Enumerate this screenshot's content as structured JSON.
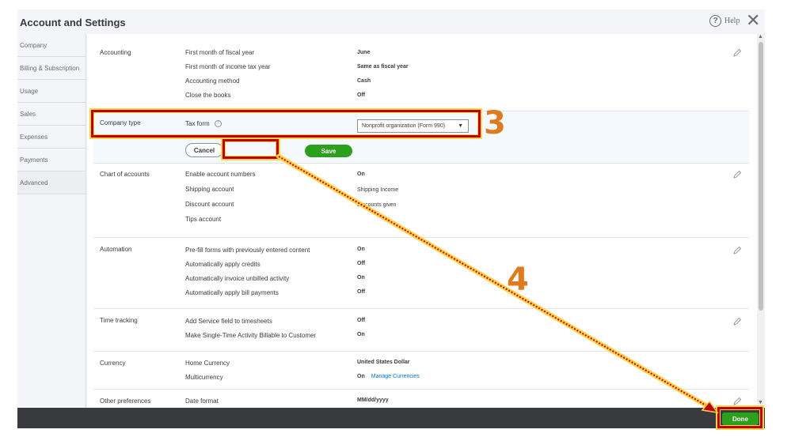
{
  "title": "Account and Settings",
  "help_label": "Help",
  "help_icon": "?",
  "close_icon": "✕",
  "sidebar": {
    "items": [
      {
        "label": "Company"
      },
      {
        "label": "Billing & Subscription"
      },
      {
        "label": "Usage"
      },
      {
        "label": "Sales"
      },
      {
        "label": "Expenses"
      },
      {
        "label": "Payments"
      },
      {
        "label": "Advanced"
      }
    ]
  },
  "accounting": {
    "label": "Accounting",
    "rows": [
      {
        "label": "First month of fiscal year",
        "value": "June"
      },
      {
        "label": "First month of income tax year",
        "value": "Same as fiscal year"
      },
      {
        "label": "Accounting method",
        "value": "Cash"
      },
      {
        "label": "Close the books",
        "value": "Off"
      }
    ]
  },
  "company_type": {
    "label": "Company type",
    "tax_form_label": "Tax form",
    "tax_form_value": "Nonprofit organization (Form 990)",
    "cancel_label": "Cancel",
    "save_label": "Save"
  },
  "chart_of_accounts": {
    "label": "Chart of accounts",
    "rows": [
      {
        "label": "Enable account numbers",
        "value": "On"
      },
      {
        "label": "Shipping account",
        "value": "Shipping Income"
      },
      {
        "label": "Discount account",
        "value": "Discounts given"
      },
      {
        "label": "Tips account",
        "value": ""
      }
    ]
  },
  "automation": {
    "label": "Automation",
    "rows": [
      {
        "label": "Pre-fill forms with previously entered content",
        "value": "On"
      },
      {
        "label": "Automatically apply credits",
        "value": "Off"
      },
      {
        "label": "Automatically invoice unbilled activity",
        "value": "On"
      },
      {
        "label": "Automatically apply bill payments",
        "value": "Off"
      }
    ]
  },
  "time_tracking": {
    "label": "Time tracking",
    "rows": [
      {
        "label": "Add Service field to timesheets",
        "value": "Off"
      },
      {
        "label": "Make Single-Time Activity Billable to Customer",
        "value": "On"
      }
    ]
  },
  "currency": {
    "label": "Currency",
    "rows": [
      {
        "label": "Home Currency",
        "value": "United States Dollar"
      },
      {
        "label": "Multicurrency",
        "value": "On",
        "link": "Manage Currencies"
      }
    ]
  },
  "other_preferences": {
    "label": "Other preferences",
    "rows": [
      {
        "label": "Date format",
        "value": "MM/dd/yyyy"
      }
    ]
  },
  "footer": {
    "done_label": "Done"
  },
  "annotations": {
    "step3": "3",
    "step4": "4"
  },
  "colors": {
    "accent_green": "#2ca01c",
    "annotation_red": "#c00000",
    "annotation_yellow": "#ffd24a",
    "step_orange": "#e07a1e",
    "footer_dark": "#393a3d",
    "link_blue": "#0077c5"
  }
}
